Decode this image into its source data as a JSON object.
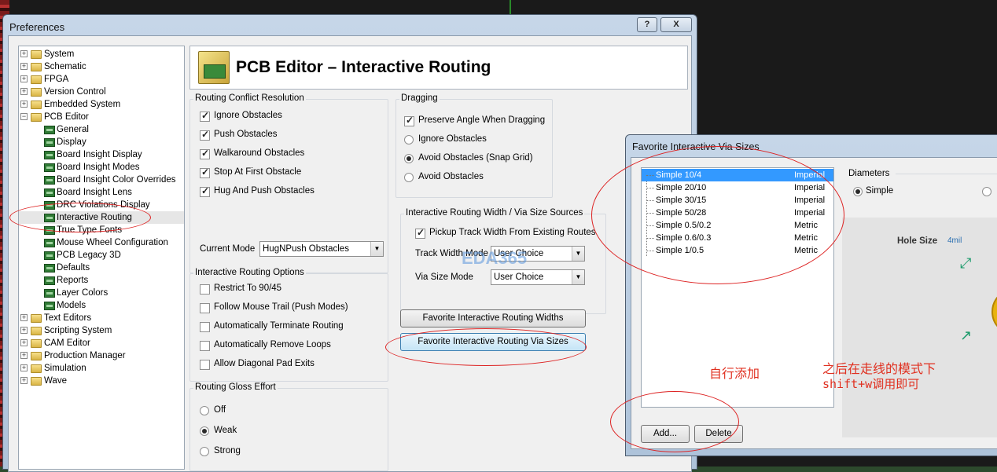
{
  "preferences": {
    "title": "Preferences",
    "help_btn": "?",
    "close_btn": "X",
    "tree": [
      {
        "label": "System",
        "kind": "folder",
        "level": 0
      },
      {
        "label": "Schematic",
        "kind": "folder",
        "level": 0
      },
      {
        "label": "FPGA",
        "kind": "folder",
        "level": 0
      },
      {
        "label": "Version Control",
        "kind": "folder",
        "level": 0
      },
      {
        "label": "Embedded System",
        "kind": "folder",
        "level": 0
      },
      {
        "label": "PCB Editor",
        "kind": "folder-open",
        "level": 0
      },
      {
        "label": "General",
        "kind": "page",
        "level": 1
      },
      {
        "label": "Display",
        "kind": "page",
        "level": 1
      },
      {
        "label": "Board Insight Display",
        "kind": "page",
        "level": 1
      },
      {
        "label": "Board Insight Modes",
        "kind": "page",
        "level": 1
      },
      {
        "label": "Board Insight Color Overrides",
        "kind": "page",
        "level": 1
      },
      {
        "label": "Board Insight Lens",
        "kind": "page",
        "level": 1
      },
      {
        "label": "DRC Violations Display",
        "kind": "page",
        "level": 1
      },
      {
        "label": "Interactive Routing",
        "kind": "page",
        "level": 1,
        "selected": true
      },
      {
        "label": "True Type Fonts",
        "kind": "page",
        "level": 1
      },
      {
        "label": "Mouse Wheel Configuration",
        "kind": "page",
        "level": 1
      },
      {
        "label": "PCB Legacy 3D",
        "kind": "page",
        "level": 1
      },
      {
        "label": "Defaults",
        "kind": "page",
        "level": 1
      },
      {
        "label": "Reports",
        "kind": "page",
        "level": 1
      },
      {
        "label": "Layer Colors",
        "kind": "page",
        "level": 1
      },
      {
        "label": "Models",
        "kind": "page",
        "level": 1
      },
      {
        "label": "Text Editors",
        "kind": "folder",
        "level": 0
      },
      {
        "label": "Scripting System",
        "kind": "folder",
        "level": 0
      },
      {
        "label": "CAM Editor",
        "kind": "folder",
        "level": 0
      },
      {
        "label": "Production Manager",
        "kind": "folder",
        "level": 0
      },
      {
        "label": "Simulation",
        "kind": "folder",
        "level": 0
      },
      {
        "label": "Wave",
        "kind": "folder",
        "level": 0
      }
    ],
    "header_title": "PCB Editor – Interactive Routing",
    "conflict": {
      "title": "Routing Conflict Resolution",
      "options": [
        {
          "label": "Ignore Obstacles",
          "checked": true
        },
        {
          "label": "Push Obstacles",
          "checked": true
        },
        {
          "label": "Walkaround Obstacles",
          "checked": true
        },
        {
          "label": "Stop At First Obstacle",
          "checked": true
        },
        {
          "label": "Hug And Push Obstacles",
          "checked": true
        }
      ],
      "current_mode_label": "Current Mode",
      "current_mode_value": "HugNPush Obstacles"
    },
    "dragging": {
      "title": "Dragging",
      "preserve_angle": "Preserve Angle When Dragging",
      "radios": [
        {
          "label": "Ignore Obstacles",
          "checked": false
        },
        {
          "label": "Avoid Obstacles (Snap Grid)",
          "checked": true
        },
        {
          "label": "Avoid Obstacles",
          "checked": false
        }
      ]
    },
    "sources": {
      "title": "Interactive Routing Width / Via Size Sources",
      "pickup": "Pickup Track Width From Existing Routes",
      "track_label": "Track Width Mode",
      "track_value": "User Choice",
      "via_label": "Via Size Mode",
      "via_value": "User Choice"
    },
    "fav_widths_btn": "Favorite Interactive Routing Widths",
    "fav_vias_btn": "Favorite Interactive Routing Via Sizes",
    "options": {
      "title": "Interactive Routing Options",
      "items": [
        {
          "label": "Restrict To 90/45",
          "checked": false
        },
        {
          "label": "Follow Mouse Trail (Push Modes)",
          "checked": false
        },
        {
          "label": "Automatically Terminate Routing",
          "checked": false
        },
        {
          "label": "Automatically Remove Loops",
          "checked": false
        },
        {
          "label": "Allow Diagonal Pad Exits",
          "checked": false
        }
      ]
    },
    "gloss": {
      "title": "Routing Gloss Effort",
      "radios": [
        {
          "label": "Off",
          "checked": false
        },
        {
          "label": "Weak",
          "checked": true
        },
        {
          "label": "Strong",
          "checked": false
        }
      ]
    },
    "watermark": "EDA365"
  },
  "favorite_dialog": {
    "title": "Favorite Interactive Via Sizes",
    "vias": [
      {
        "name": "Simple 10/4",
        "unit": "Imperial",
        "selected": true
      },
      {
        "name": "Simple 20/10",
        "unit": "Imperial"
      },
      {
        "name": "Simple 30/15",
        "unit": "Imperial"
      },
      {
        "name": "Simple 50/28",
        "unit": "Imperial"
      },
      {
        "name": "Simple 0.5/0.2",
        "unit": "Metric"
      },
      {
        "name": "Simple 0.6/0.3",
        "unit": "Metric"
      },
      {
        "name": "Simple 1/0.5",
        "unit": "Metric"
      }
    ],
    "diameters_title": "Diameters",
    "simple_radio": "Simple",
    "hole_size_label": "Hole Size",
    "hole_size_value": "4mil",
    "add_btn": "Add...",
    "delete_btn": "Delete"
  },
  "annotations": {
    "add_note": "自行添加",
    "usage_line1": "之后在走线的模式下",
    "usage_line2": "shift+w调用即可"
  },
  "colors": {
    "accent": "#3399ff",
    "annotation": "#e03020"
  }
}
